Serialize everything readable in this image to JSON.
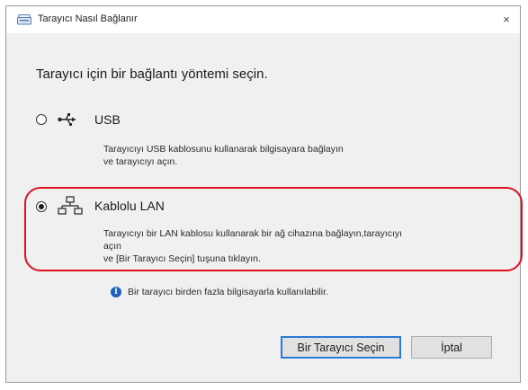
{
  "window": {
    "title": "Tarayıcı Nasıl Bağlanır",
    "close_glyph": "×"
  },
  "heading": "Tarayıcı için bir bağlantı yöntemi seçin.",
  "options": [
    {
      "label": "USB",
      "icon": "usb-icon",
      "selected": false,
      "description_lines": [
        "Tarayıcıyı USB kablosunu kullanarak bilgisayara bağlayın",
        "ve tarayıcıyı açın."
      ]
    },
    {
      "label": "Kablolu LAN",
      "icon": "network-icon",
      "selected": true,
      "highlighted": true,
      "description_lines": [
        "Tarayıcıyı bir LAN kablosu kullanarak bir ağ cihazına bağlayın,tarayıcıyı",
        "açın",
        "ve [Bir Tarayıcı Seçin] tuşuna tıklayın."
      ]
    }
  ],
  "info": {
    "icon": "info-icon",
    "text": "Bir tarayıcı birden fazla bilgisayarla kullanılabilir."
  },
  "buttons": {
    "select": "Bir Tarayıcı Seçin",
    "cancel": "İptal"
  },
  "colors": {
    "highlight": "#e01020",
    "default_button_border": "#2b7ad6",
    "info_icon": "#1f5fbf"
  }
}
